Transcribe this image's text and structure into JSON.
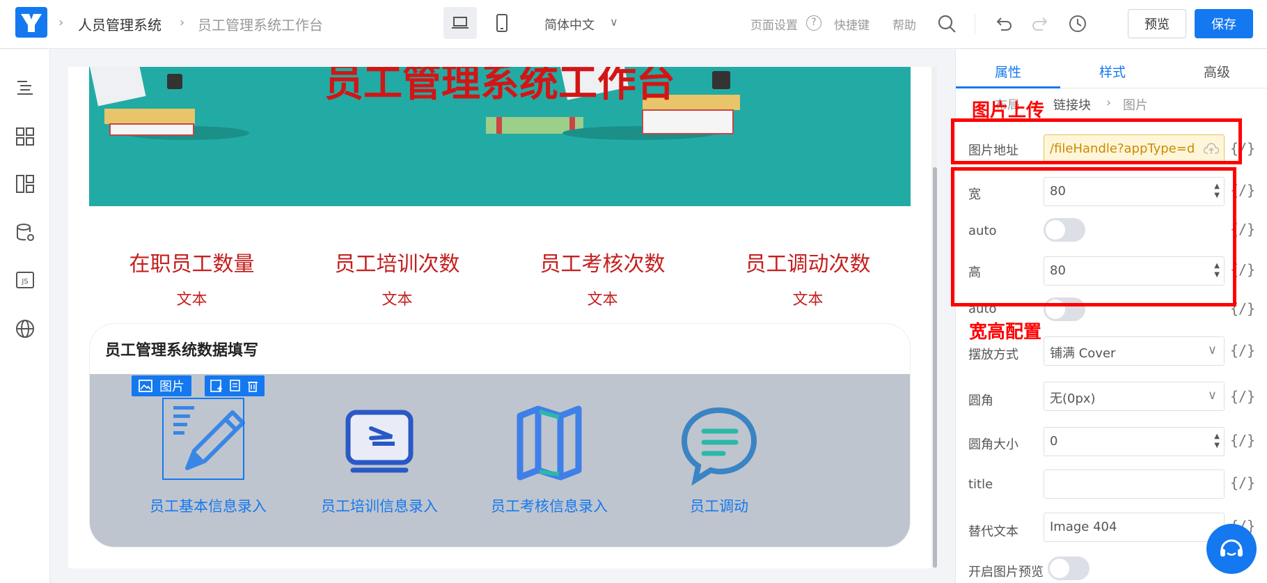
{
  "header": {
    "breadcrumb": [
      "人员管理系统",
      "员工管理系统工作台"
    ],
    "language": "简体中文",
    "links": [
      "页面设置",
      "快捷键",
      "帮助"
    ],
    "preview_label": "预览",
    "save_label": "保存"
  },
  "canvas": {
    "banner_title": "员工管理系统工作台",
    "stats": [
      {
        "label": "在职员工数量",
        "value": "文本"
      },
      {
        "label": "员工培训次数",
        "value": "文本"
      },
      {
        "label": "员工考核次数",
        "value": "文本"
      },
      {
        "label": "员工调动次数",
        "value": "文本"
      }
    ],
    "form_title": "员工管理系统数据填写",
    "selected_tag": "图片",
    "items": [
      {
        "label": "员工基本信息录入",
        "icon": "pencil-note-icon"
      },
      {
        "label": "员工培训信息录入",
        "icon": "monitor-arrow-icon"
      },
      {
        "label": "员工考核信息录入",
        "icon": "map-icon"
      },
      {
        "label": "员工调动",
        "icon": "chat-bubble-icon"
      }
    ]
  },
  "panel": {
    "tabs": [
      "属性",
      "样式",
      "高级"
    ],
    "crumbs": [
      "布局",
      "链接块",
      "图片"
    ],
    "fields": {
      "src_label": "图片地址",
      "src_value": "/fileHandle?appType=d",
      "width_label": "宽",
      "width_value": "80",
      "auto1_label": "auto",
      "height_label": "高",
      "height_value": "80",
      "auto2_label": "auto",
      "fit_label": "摆放方式",
      "fit_value": "铺满 Cover",
      "radius_label": "圆角",
      "radius_value": "无(0px)",
      "radius_size_label": "圆角大小",
      "radius_size_value": "0",
      "title_label": "title",
      "title_value": "",
      "alt_label": "替代文本",
      "alt_value": "Image 404",
      "preview_label": "开启图片预览"
    },
    "bind_symbol": "{/}"
  },
  "annotations": {
    "upload": "图片上传",
    "size": "宽高配置"
  },
  "colors": {
    "accent": "#1478f0",
    "annotation": "#ff0000",
    "banner": "#22aba4"
  }
}
